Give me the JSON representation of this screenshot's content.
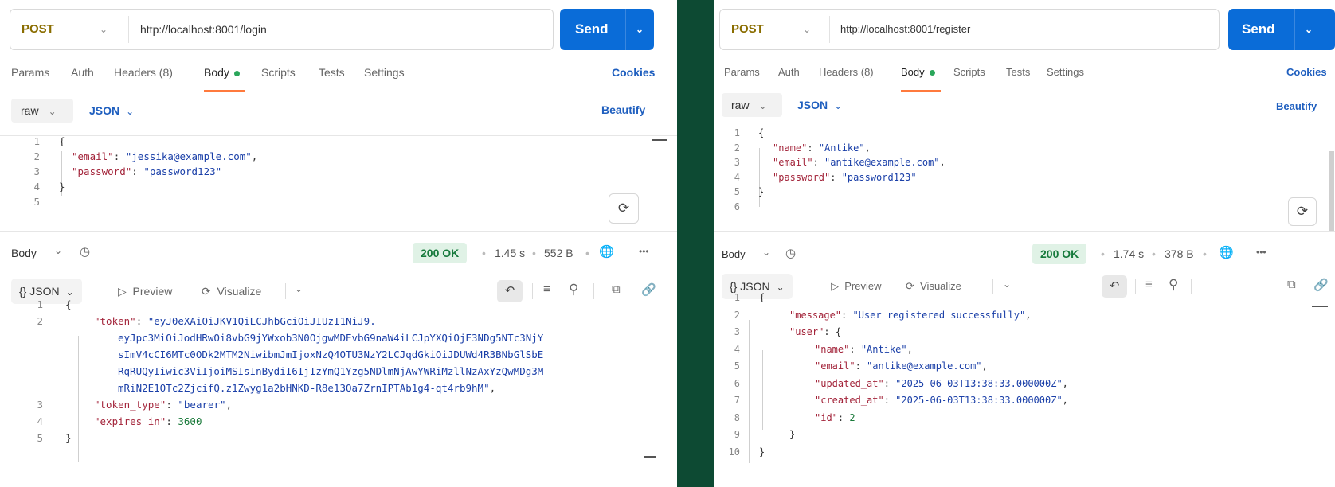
{
  "left": {
    "method": "POST",
    "url": "http://localhost:8001/login",
    "send_label": "Send",
    "tabs": [
      "Params",
      "Auth",
      "Headers (8)",
      "Body",
      "Scripts",
      "Tests",
      "Settings"
    ],
    "cookies": "Cookies",
    "body_mode": "raw",
    "body_lang": "JSON",
    "beautify": "Beautify",
    "request_line_numbers": [
      "1",
      "2",
      "3",
      "4",
      "5"
    ],
    "request_lines": [
      {
        "punc": "{"
      },
      {
        "key": "\"email\"",
        "sep": ": ",
        "val": "\"jessika@example.com\"",
        "tail": ","
      },
      {
        "key": "\"password\"",
        "sep": ": ",
        "val": "\"password123\"",
        "tail": ""
      },
      {
        "punc": "}"
      },
      {
        "punc": ""
      }
    ],
    "response": {
      "label": "Body",
      "status": "200 OK",
      "time": "1.45 s",
      "size": "552 B",
      "format": "{} JSON",
      "preview": "Preview",
      "visualize": "Visualize",
      "line_numbers": [
        "1",
        "2",
        "",
        "",
        "",
        "",
        "3",
        "4",
        "5"
      ],
      "lines": [
        {
          "punc": "{"
        },
        {
          "key": "\"token\"",
          "sep": ": ",
          "val": "\"eyJ0eXAiOiJKV1QiLCJhbGciOiJIUzI1NiJ9.",
          "tail": ""
        },
        {
          "val": "eyJpc3MiOiJodHRwOi8vbG9jYWxob3N0OjgwMDEvbG9naW4iLCJpYXQiOjE3NDg5NTc3NjY"
        },
        {
          "val": "sImV4cCI6MTc0ODk2MTM2NiwibmJmIjoxNzQ4OTU3NzY2LCJqdGkiOiJDUWd4R3BNbGlSbE"
        },
        {
          "val": "RqRUQyIiwic3ViIjoiMSIsInBydiI6IjIzYmQ1Yzg5NDlmNjAwYWRiMzllNzAxYzQwMDg3M"
        },
        {
          "val": "mRiN2E1OTc2ZjcifQ.z1Zwyg1a2bHNKD-R8e13Qa7ZrnIPTAb1g4-qt4rb9hM\"",
          "tail": ","
        },
        {
          "key": "\"token_type\"",
          "sep": ": ",
          "val": "\"bearer\"",
          "tail": ","
        },
        {
          "key": "\"expires_in\"",
          "sep": ": ",
          "num": "3600"
        },
        {
          "punc": "}"
        }
      ]
    }
  },
  "right": {
    "method": "POST",
    "url": "http://localhost:8001/register",
    "send_label": "Send",
    "tabs": [
      "Params",
      "Auth",
      "Headers (8)",
      "Body",
      "Scripts",
      "Tests",
      "Settings"
    ],
    "cookies": "Cookies",
    "body_mode": "raw",
    "body_lang": "JSON",
    "beautify": "Beautify",
    "request_line_numbers": [
      "1",
      "2",
      "3",
      "4",
      "5",
      "6"
    ],
    "request_lines": [
      {
        "punc": "{"
      },
      {
        "key": "\"name\"",
        "sep": ": ",
        "val": "\"Antike\"",
        "tail": ","
      },
      {
        "key": "\"email\"",
        "sep": ": ",
        "val": "\"antike@example.com\"",
        "tail": ","
      },
      {
        "key": "\"password\"",
        "sep": ": ",
        "val": "\"password123\"",
        "tail": ""
      },
      {
        "punc": "}"
      },
      {
        "punc": ""
      }
    ],
    "response": {
      "label": "Body",
      "status": "200 OK",
      "time": "1.74 s",
      "size": "378 B",
      "format": "{} JSON",
      "preview": "Preview",
      "visualize": "Visualize",
      "line_numbers": [
        "1",
        "2",
        "3",
        "4",
        "5",
        "6",
        "7",
        "8",
        "9",
        "10"
      ],
      "lines": [
        {
          "punc": "{"
        },
        {
          "key": "\"message\"",
          "sep": ": ",
          "val": "\"User registered successfully\"",
          "tail": ","
        },
        {
          "key": "\"user\"",
          "sep": ": ",
          "punc": "{"
        },
        {
          "key": "\"name\"",
          "sep": ": ",
          "val": "\"Antike\"",
          "tail": ","
        },
        {
          "key": "\"email\"",
          "sep": ": ",
          "val": "\"antike@example.com\"",
          "tail": ","
        },
        {
          "key": "\"updated_at\"",
          "sep": ": ",
          "val": "\"2025-06-03T13:38:33.000000Z\"",
          "tail": ","
        },
        {
          "key": "\"created_at\"",
          "sep": ": ",
          "val": "\"2025-06-03T13:38:33.000000Z\"",
          "tail": ","
        },
        {
          "key": "\"id\"",
          "sep": ": ",
          "num": "2"
        },
        {
          "punc": "}"
        },
        {
          "punc": "}"
        }
      ]
    }
  }
}
